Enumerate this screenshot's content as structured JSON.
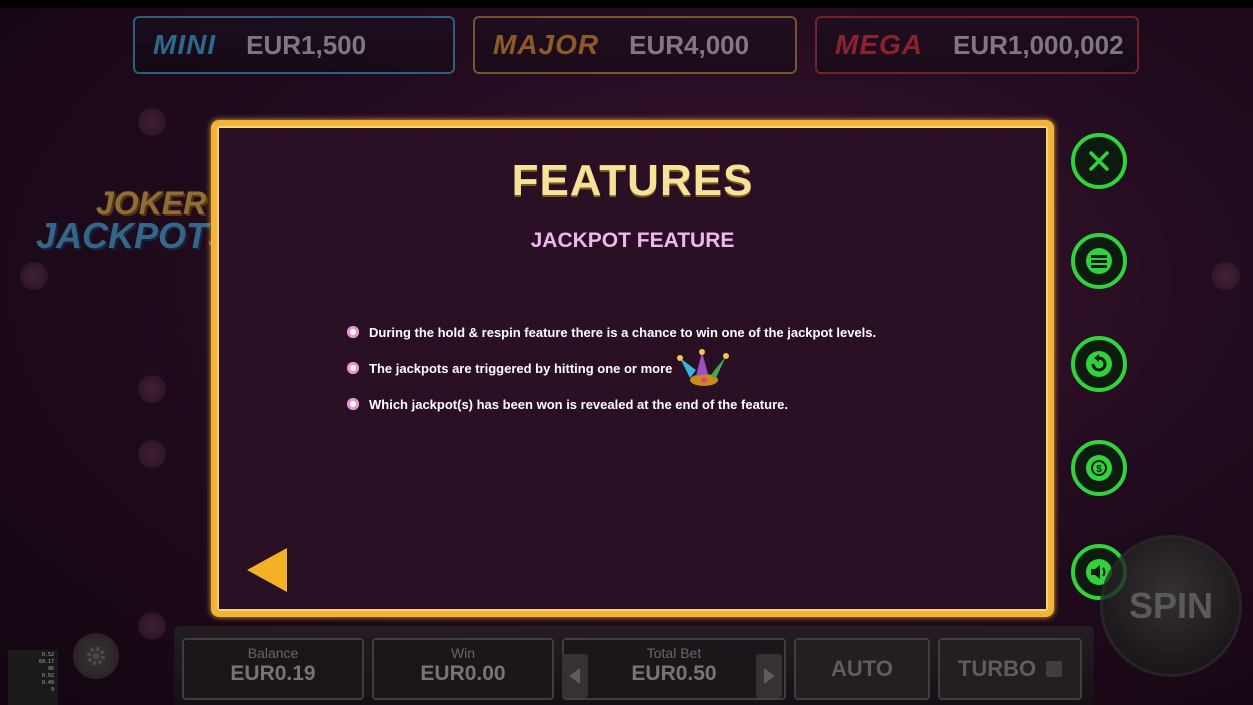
{
  "jackpots": [
    {
      "name": "MINI",
      "value": "EUR1,500"
    },
    {
      "name": "MAJOR",
      "value": "EUR4,000"
    },
    {
      "name": "MEGA",
      "value": "EUR1,000,002"
    }
  ],
  "logo": {
    "line1": "JOKER",
    "line2": "JACKPOTS"
  },
  "panel": {
    "title": "FEATURES",
    "subtitle": "JACKPOT FEATURE",
    "bullets": [
      "During the hold & respin feature there is a chance to win one of the jackpot levels.",
      "The jackpots are triggered by hitting one or more",
      "Which jackpot(s) has been won is revealed at the end of the feature."
    ]
  },
  "side_buttons": [
    "close-icon",
    "menu-icon",
    "history-icon",
    "coin-icon",
    "sound-icon"
  ],
  "spin": {
    "label": "SPIN"
  },
  "bottom": {
    "balance_label": "Balance",
    "balance_value": "EUR0.19",
    "win_label": "Win",
    "win_value": "EUR0.00",
    "bet_label": "Total Bet",
    "bet_value": "EUR0.50",
    "auto_label": "AUTO",
    "turbo_label": "TURBO"
  },
  "stats": [
    "0.52",
    "60.17",
    "96",
    "0.02",
    "0.49",
    "9"
  ],
  "colors": {
    "panel_border": "#f1b338",
    "accent_green": "#2fd43a",
    "title": "#f6e29a",
    "subtitle": "#f1b6ef"
  }
}
